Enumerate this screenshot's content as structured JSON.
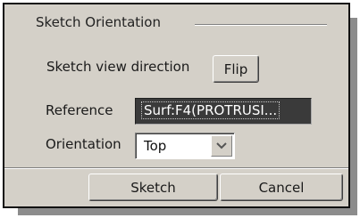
{
  "dialog": {
    "group_title": "Sketch Orientation",
    "view_direction_label": "Sketch view direction",
    "flip_button": "Flip",
    "reference_label": "Reference",
    "reference_value": "Surf:F4(PROTRUSI...",
    "orientation_label": "Orientation",
    "orientation_value": "Top",
    "sketch_button": "Sketch",
    "cancel_button": "Cancel"
  },
  "icons": {
    "dropdown": "chevron-down-icon"
  },
  "colors": {
    "dialog_background": "#d4d0c8",
    "reference_field_background": "#3a3a3a",
    "reference_text": "#ffffff",
    "drop_shadow": "#8c8c8c"
  }
}
